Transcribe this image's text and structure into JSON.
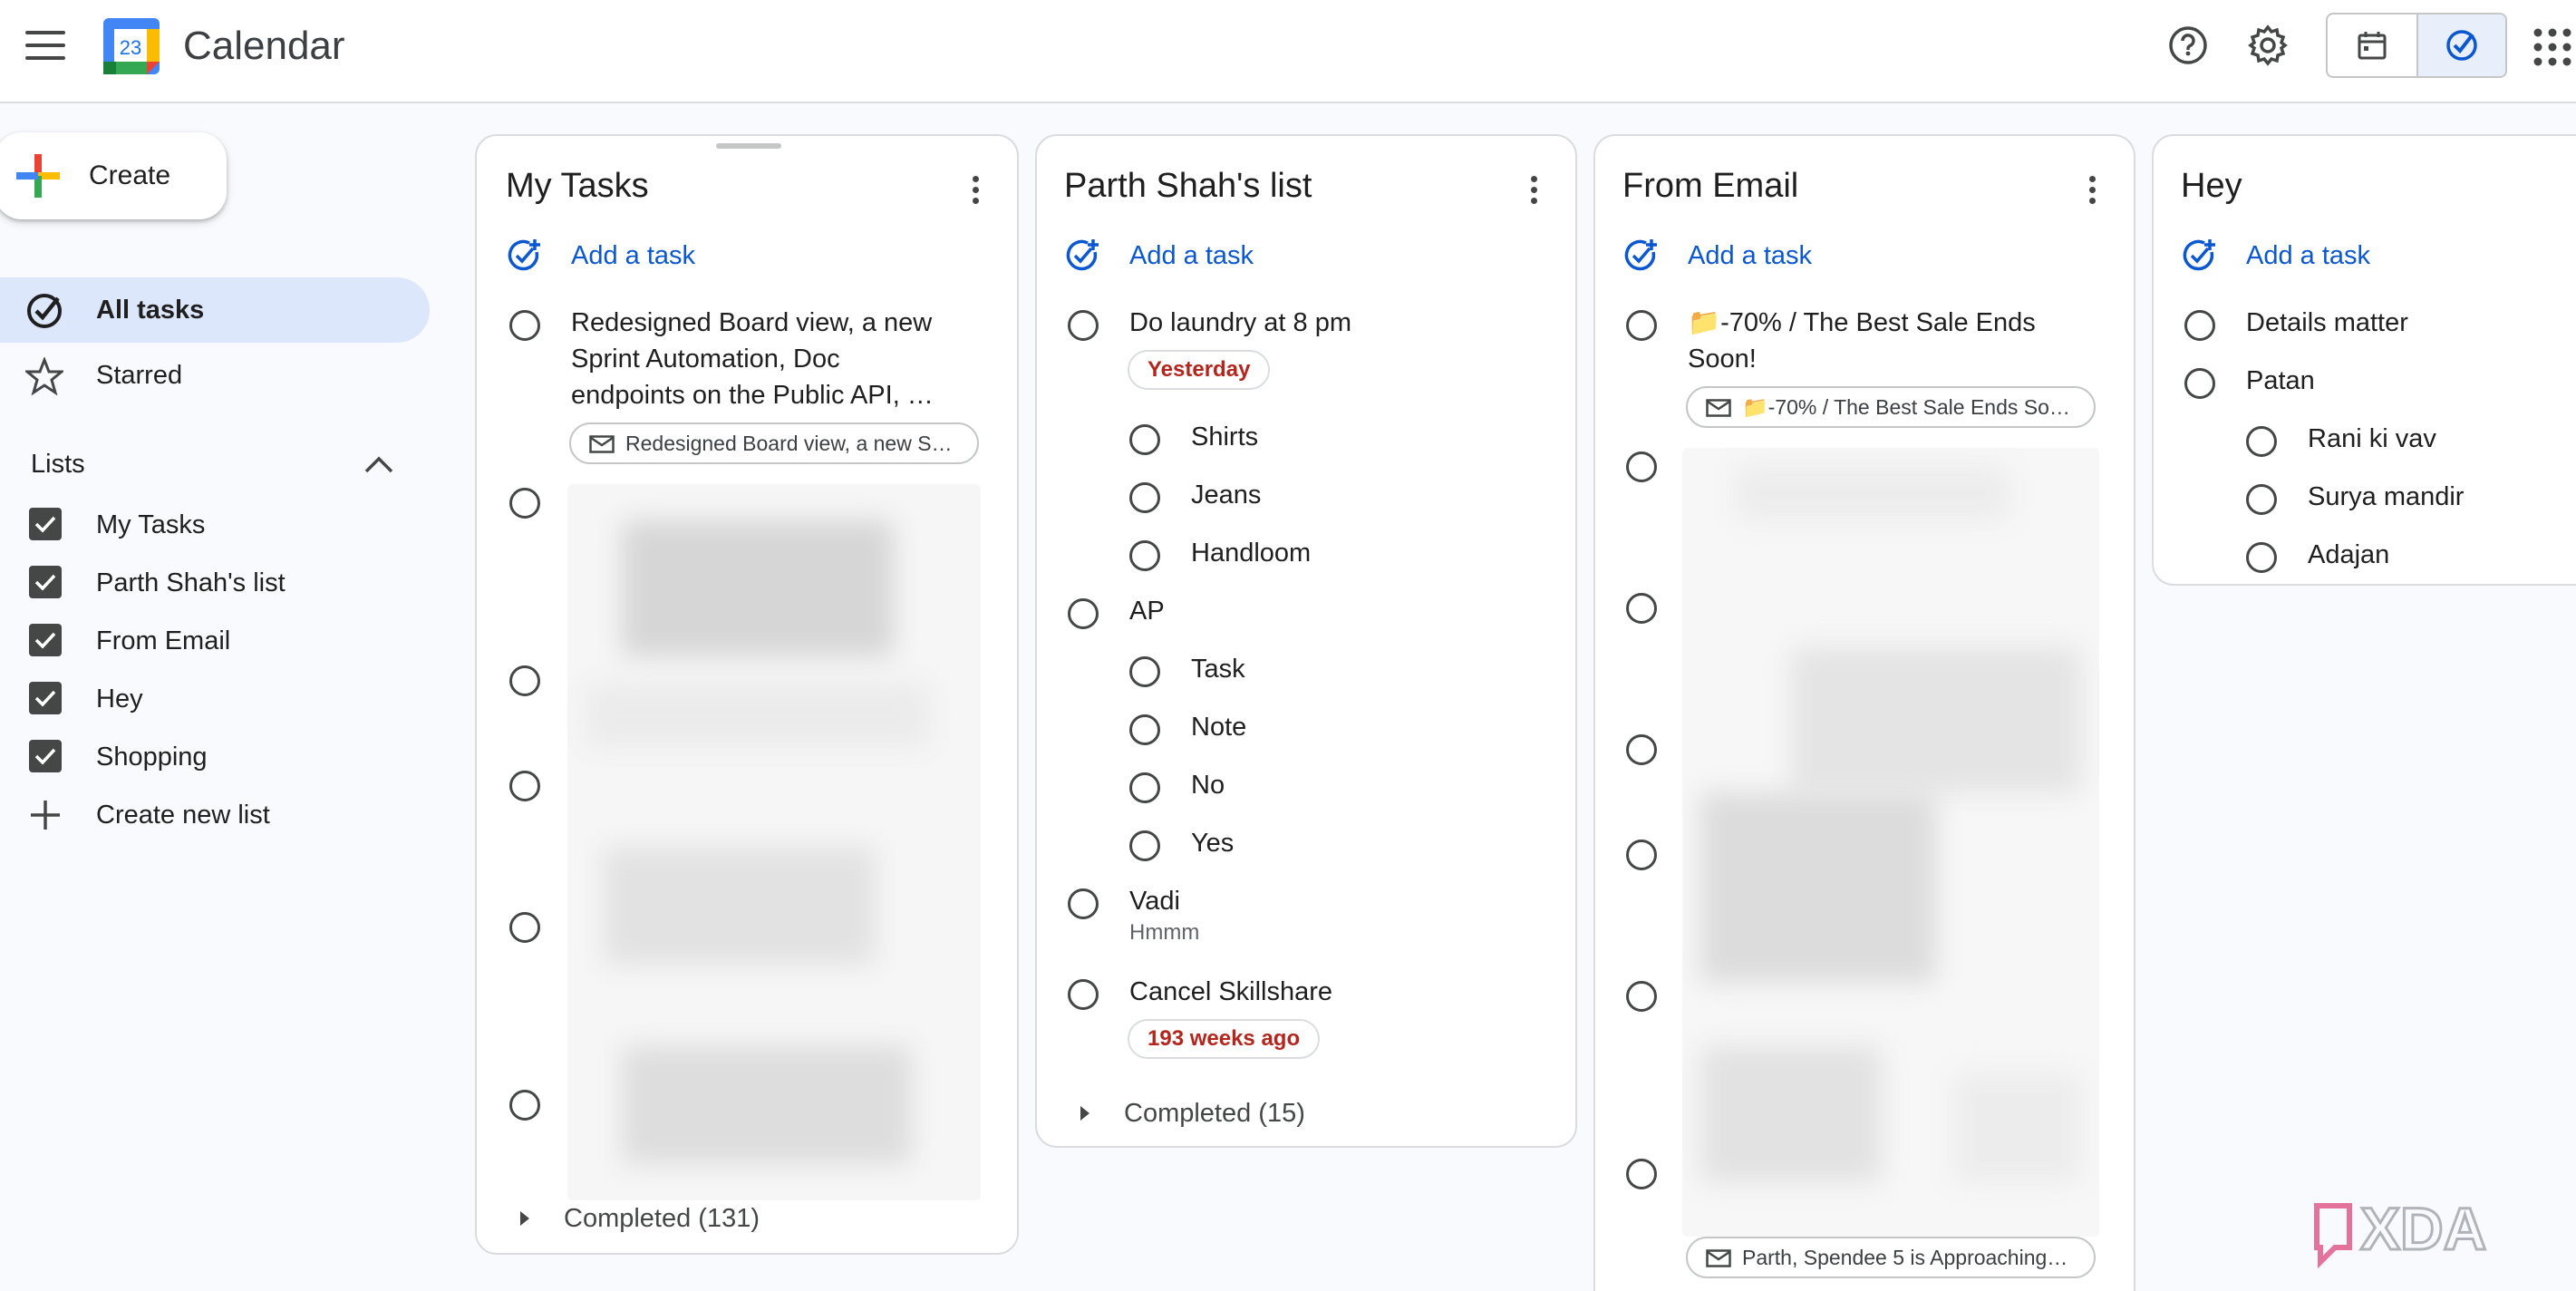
{
  "header": {
    "app_title": "Calendar",
    "logo_day": "23",
    "icons": [
      "menu-icon",
      "help-icon",
      "settings-icon",
      "calendar-view-icon",
      "tasks-view-icon",
      "apps-icon"
    ]
  },
  "sidebar": {
    "create_label": "Create",
    "nav": [
      {
        "label": "All tasks",
        "icon": "check-circle-icon",
        "active": true
      },
      {
        "label": "Starred",
        "icon": "star-icon",
        "active": false
      }
    ],
    "lists_header": "Lists",
    "lists": [
      {
        "label": "My Tasks",
        "checked": true
      },
      {
        "label": "Parth Shah's list",
        "checked": true
      },
      {
        "label": "From Email",
        "checked": true
      },
      {
        "label": "Hey",
        "checked": true
      },
      {
        "label": "Shopping",
        "checked": true
      }
    ],
    "create_new_list": "Create new list"
  },
  "columns": {
    "my_tasks": {
      "title": "My Tasks",
      "add_task": "Add a task",
      "task1_line1": "Redesigned Board view, a new",
      "task1_line2": "Sprint Automation, Doc",
      "task1_line3": "endpoints on the Public API, …",
      "task1_chip": "Redesigned Board view, a new S…",
      "completed": "Completed (131)"
    },
    "parth": {
      "title": "Parth Shah's list",
      "add_task": "Add a task",
      "tasks": [
        {
          "text": "Do laundry at 8 pm",
          "date": "Yesterday"
        },
        {
          "text": "Shirts"
        },
        {
          "text": "Jeans"
        },
        {
          "text": "Handloom"
        },
        {
          "text": "AP"
        },
        {
          "text": "Task"
        },
        {
          "text": "Note"
        },
        {
          "text": "No"
        },
        {
          "text": "Yes"
        },
        {
          "text": "Vadi",
          "note": "Hmmm"
        },
        {
          "text": "Cancel Skillshare",
          "date": "193 weeks ago"
        }
      ],
      "completed": "Completed (15)"
    },
    "from_email": {
      "title": "From Email",
      "add_task": "Add a task",
      "task1_line1": "📁-70% / The Best Sale Ends",
      "task1_line2": "Soon!",
      "task1_chip": "📁-70% / The Best Sale Ends So…",
      "last_chip": "Parth, Spendee 5 is Approaching…"
    },
    "hey": {
      "title": "Hey",
      "add_task": "Add a task",
      "tasks": [
        "Details matter",
        "Patan",
        "Rani ki vav",
        "Surya mandir",
        "Adajan"
      ]
    }
  },
  "watermark": "XDA",
  "colors": {
    "accent": "#0b57d0",
    "active_nav": "#dde7fb",
    "overdue": "#b3261e"
  }
}
